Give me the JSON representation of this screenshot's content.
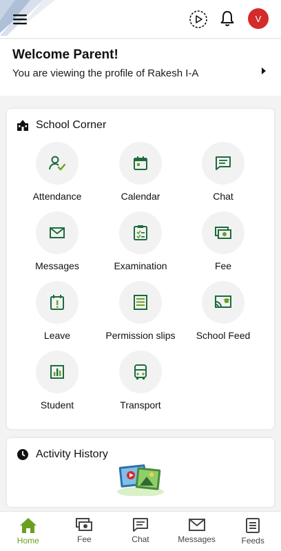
{
  "header": {
    "avatar_initial": "V",
    "accent": "#1d6a3e",
    "avatar_color": "#d42a2a"
  },
  "welcome": {
    "title": "Welcome Parent!",
    "subtitle": "You are viewing the profile of Rakesh I-A"
  },
  "school_corner": {
    "title": "School Corner",
    "items": [
      {
        "label": "Attendance",
        "icon": "attendance-icon"
      },
      {
        "label": "Calendar",
        "icon": "calendar-icon"
      },
      {
        "label": "Chat",
        "icon": "chat-icon"
      },
      {
        "label": "Messages",
        "icon": "envelope-icon"
      },
      {
        "label": "Examination",
        "icon": "clipboard-icon"
      },
      {
        "label": "Fee",
        "icon": "money-icon"
      },
      {
        "label": "Leave",
        "icon": "leave-icon"
      },
      {
        "label": "Permission slips",
        "icon": "slip-icon"
      },
      {
        "label": "School Feed",
        "icon": "cast-icon"
      },
      {
        "label": "Student",
        "icon": "bar-chart-icon"
      },
      {
        "label": "Transport",
        "icon": "bus-icon"
      }
    ]
  },
  "activity": {
    "title": "Activity History"
  },
  "bottom_nav": {
    "items": [
      {
        "label": "Home",
        "icon": "home-icon",
        "active": true
      },
      {
        "label": "Fee",
        "icon": "money-icon"
      },
      {
        "label": "Chat",
        "icon": "chat-icon"
      },
      {
        "label": "Messages",
        "icon": "envelope-icon"
      },
      {
        "label": "Feeds",
        "icon": "feeds-icon"
      }
    ],
    "active_color": "#6aa020"
  }
}
